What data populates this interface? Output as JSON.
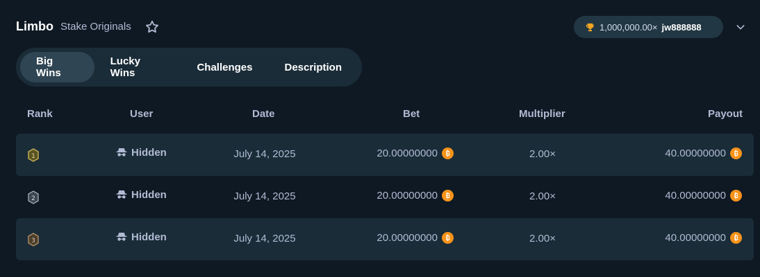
{
  "header": {
    "title": "Limbo",
    "subtitle": "Stake Originals",
    "record": {
      "value": "1,000,000.00×",
      "user": "jw888888"
    }
  },
  "tabs": [
    {
      "label": "Big Wins",
      "active": true
    },
    {
      "label": "Lucky Wins",
      "active": false
    },
    {
      "label": "Challenges",
      "active": false
    },
    {
      "label": "Description",
      "active": false
    }
  ],
  "table": {
    "columns": [
      "Rank",
      "User",
      "Date",
      "Bet",
      "Multiplier",
      "Payout"
    ],
    "rows": [
      {
        "rank": "1",
        "user": "Hidden",
        "date": "July 14, 2025",
        "bet": "20.00000000",
        "multiplier": "2.00×",
        "payout": "40.00000000"
      },
      {
        "rank": "2",
        "user": "Hidden",
        "date": "July 14, 2025",
        "bet": "20.00000000",
        "multiplier": "2.00×",
        "payout": "40.00000000"
      },
      {
        "rank": "3",
        "user": "Hidden",
        "date": "July 14, 2025",
        "bet": "20.00000000",
        "multiplier": "2.00×",
        "payout": "40.00000000"
      }
    ]
  },
  "icons": {
    "favorite": "star-icon",
    "record": "trophy-icon",
    "expand": "chevron-down-icon",
    "user": "incognito-icon",
    "currency": "bitcoin-icon"
  },
  "colors": {
    "background": "#0f1923",
    "surface": "#1a2c38",
    "active_tab": "#2f4553",
    "pill": "#213743",
    "text_muted": "#b1bad3",
    "bitcoin": "#f7931a",
    "trophy": "#f5a623",
    "rank_gold": "#c9b458"
  }
}
